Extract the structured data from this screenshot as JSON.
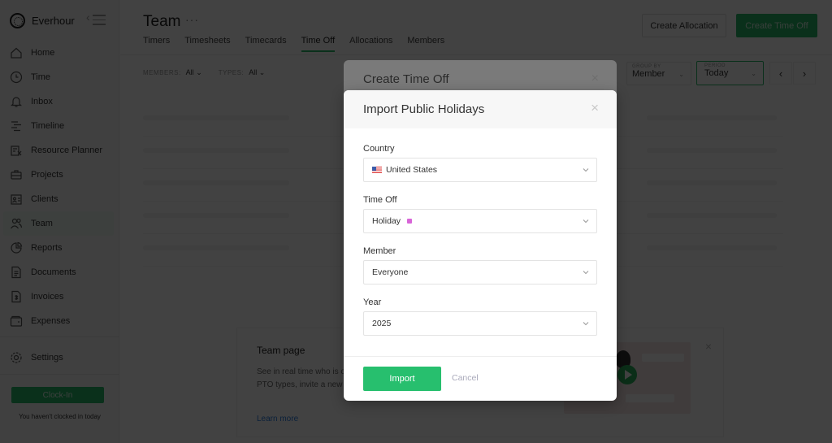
{
  "sidebar": {
    "brand": "Everhour",
    "items": [
      {
        "label": "Home",
        "icon": "home-icon"
      },
      {
        "label": "Time",
        "icon": "clock-icon"
      },
      {
        "label": "Inbox",
        "icon": "bell-icon"
      },
      {
        "label": "Timeline",
        "icon": "timeline-icon"
      },
      {
        "label": "Resource Planner",
        "icon": "resource-planner-icon"
      },
      {
        "label": "Projects",
        "icon": "briefcase-icon"
      },
      {
        "label": "Clients",
        "icon": "contact-card-icon"
      },
      {
        "label": "Team",
        "icon": "users-icon",
        "active": true
      },
      {
        "label": "Reports",
        "icon": "pie-chart-icon"
      },
      {
        "label": "Documents",
        "icon": "document-icon"
      },
      {
        "label": "Invoices",
        "icon": "invoice-icon"
      },
      {
        "label": "Expenses",
        "icon": "wallet-icon"
      }
    ],
    "settings": "Settings",
    "clock_in": "Clock-In",
    "clock_status": "You haven't clocked in today"
  },
  "header": {
    "title": "Team",
    "more": "···",
    "tabs": [
      "Timers",
      "Timesheets",
      "Timecards",
      "Time Off",
      "Allocations",
      "Members"
    ],
    "active_tab": "Time Off",
    "create_allocation": "Create Allocation",
    "create_time_off": "Create Time Off"
  },
  "filters": {
    "members_label": "Members:",
    "members_value": "All",
    "types_label": "Types:",
    "types_value": "All",
    "group_by_label": "Group by",
    "group_by_value": "Member",
    "period_label": "Period",
    "period_value": "Today",
    "prev": "‹",
    "next": "›"
  },
  "promo": {
    "title": "Team page",
    "text": "See in real time who is on timesheets and timecards PTO types, invite a new",
    "link": "Learn more",
    "close": "×"
  },
  "back_modal": {
    "title": "Create Time Off",
    "close": "×"
  },
  "modal": {
    "title": "Import Public Holidays",
    "close": "×",
    "fields": [
      {
        "label": "Country",
        "value": "United States"
      },
      {
        "label": "Time Off",
        "value": "Holiday",
        "color": "#d865d8"
      },
      {
        "label": "Member",
        "value": "Everyone"
      },
      {
        "label": "Year",
        "value": "2025"
      }
    ],
    "import": "Import",
    "cancel": "Cancel"
  }
}
